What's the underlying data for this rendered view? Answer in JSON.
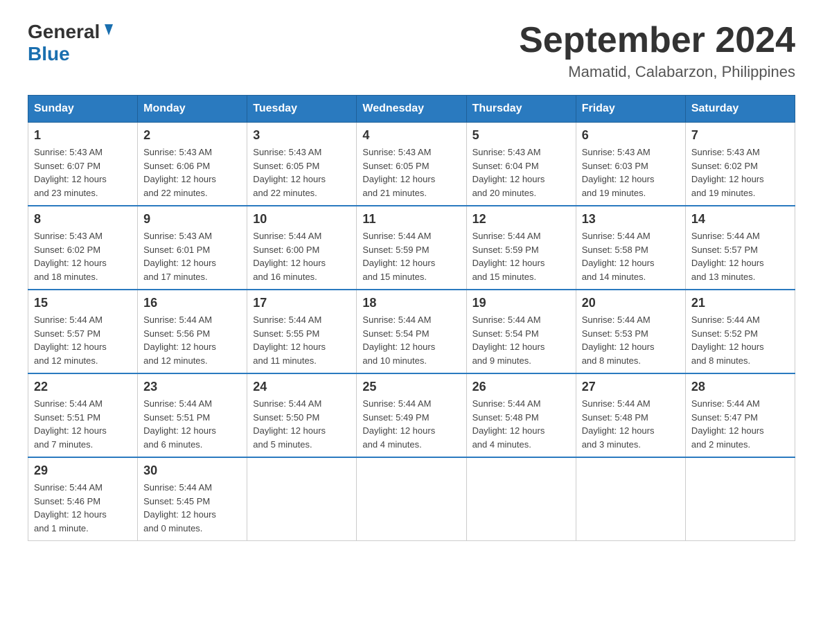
{
  "header": {
    "logo_general": "General",
    "logo_blue": "Blue",
    "title": "September 2024",
    "location": "Mamatid, Calabarzon, Philippines"
  },
  "days_of_week": [
    "Sunday",
    "Monday",
    "Tuesday",
    "Wednesday",
    "Thursday",
    "Friday",
    "Saturday"
  ],
  "weeks": [
    [
      {
        "day": "1",
        "sunrise": "5:43 AM",
        "sunset": "6:07 PM",
        "daylight": "12 hours and 23 minutes."
      },
      {
        "day": "2",
        "sunrise": "5:43 AM",
        "sunset": "6:06 PM",
        "daylight": "12 hours and 22 minutes."
      },
      {
        "day": "3",
        "sunrise": "5:43 AM",
        "sunset": "6:05 PM",
        "daylight": "12 hours and 22 minutes."
      },
      {
        "day": "4",
        "sunrise": "5:43 AM",
        "sunset": "6:05 PM",
        "daylight": "12 hours and 21 minutes."
      },
      {
        "day": "5",
        "sunrise": "5:43 AM",
        "sunset": "6:04 PM",
        "daylight": "12 hours and 20 minutes."
      },
      {
        "day": "6",
        "sunrise": "5:43 AM",
        "sunset": "6:03 PM",
        "daylight": "12 hours and 19 minutes."
      },
      {
        "day": "7",
        "sunrise": "5:43 AM",
        "sunset": "6:02 PM",
        "daylight": "12 hours and 19 minutes."
      }
    ],
    [
      {
        "day": "8",
        "sunrise": "5:43 AM",
        "sunset": "6:02 PM",
        "daylight": "12 hours and 18 minutes."
      },
      {
        "day": "9",
        "sunrise": "5:43 AM",
        "sunset": "6:01 PM",
        "daylight": "12 hours and 17 minutes."
      },
      {
        "day": "10",
        "sunrise": "5:44 AM",
        "sunset": "6:00 PM",
        "daylight": "12 hours and 16 minutes."
      },
      {
        "day": "11",
        "sunrise": "5:44 AM",
        "sunset": "5:59 PM",
        "daylight": "12 hours and 15 minutes."
      },
      {
        "day": "12",
        "sunrise": "5:44 AM",
        "sunset": "5:59 PM",
        "daylight": "12 hours and 15 minutes."
      },
      {
        "day": "13",
        "sunrise": "5:44 AM",
        "sunset": "5:58 PM",
        "daylight": "12 hours and 14 minutes."
      },
      {
        "day": "14",
        "sunrise": "5:44 AM",
        "sunset": "5:57 PM",
        "daylight": "12 hours and 13 minutes."
      }
    ],
    [
      {
        "day": "15",
        "sunrise": "5:44 AM",
        "sunset": "5:57 PM",
        "daylight": "12 hours and 12 minutes."
      },
      {
        "day": "16",
        "sunrise": "5:44 AM",
        "sunset": "5:56 PM",
        "daylight": "12 hours and 12 minutes."
      },
      {
        "day": "17",
        "sunrise": "5:44 AM",
        "sunset": "5:55 PM",
        "daylight": "12 hours and 11 minutes."
      },
      {
        "day": "18",
        "sunrise": "5:44 AM",
        "sunset": "5:54 PM",
        "daylight": "12 hours and 10 minutes."
      },
      {
        "day": "19",
        "sunrise": "5:44 AM",
        "sunset": "5:54 PM",
        "daylight": "12 hours and 9 minutes."
      },
      {
        "day": "20",
        "sunrise": "5:44 AM",
        "sunset": "5:53 PM",
        "daylight": "12 hours and 8 minutes."
      },
      {
        "day": "21",
        "sunrise": "5:44 AM",
        "sunset": "5:52 PM",
        "daylight": "12 hours and 8 minutes."
      }
    ],
    [
      {
        "day": "22",
        "sunrise": "5:44 AM",
        "sunset": "5:51 PM",
        "daylight": "12 hours and 7 minutes."
      },
      {
        "day": "23",
        "sunrise": "5:44 AM",
        "sunset": "5:51 PM",
        "daylight": "12 hours and 6 minutes."
      },
      {
        "day": "24",
        "sunrise": "5:44 AM",
        "sunset": "5:50 PM",
        "daylight": "12 hours and 5 minutes."
      },
      {
        "day": "25",
        "sunrise": "5:44 AM",
        "sunset": "5:49 PM",
        "daylight": "12 hours and 4 minutes."
      },
      {
        "day": "26",
        "sunrise": "5:44 AM",
        "sunset": "5:48 PM",
        "daylight": "12 hours and 4 minutes."
      },
      {
        "day": "27",
        "sunrise": "5:44 AM",
        "sunset": "5:48 PM",
        "daylight": "12 hours and 3 minutes."
      },
      {
        "day": "28",
        "sunrise": "5:44 AM",
        "sunset": "5:47 PM",
        "daylight": "12 hours and 2 minutes."
      }
    ],
    [
      {
        "day": "29",
        "sunrise": "5:44 AM",
        "sunset": "5:46 PM",
        "daylight": "12 hours and 1 minute."
      },
      {
        "day": "30",
        "sunrise": "5:44 AM",
        "sunset": "5:45 PM",
        "daylight": "12 hours and 0 minutes."
      },
      null,
      null,
      null,
      null,
      null
    ]
  ],
  "labels": {
    "sunrise": "Sunrise:",
    "sunset": "Sunset:",
    "daylight": "Daylight:"
  }
}
